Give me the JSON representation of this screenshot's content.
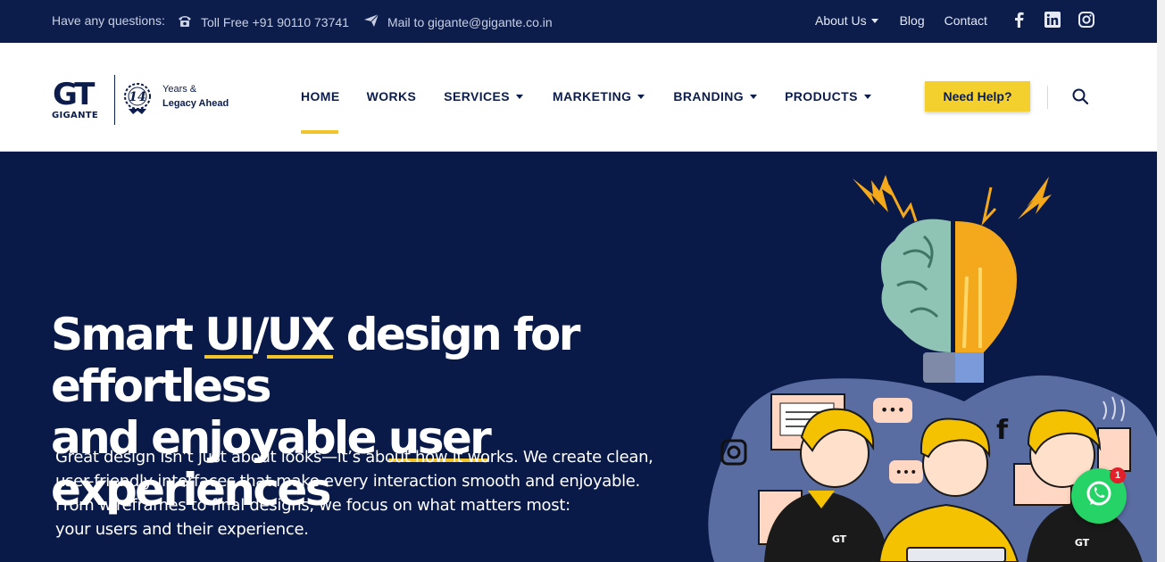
{
  "topbar": {
    "question_label": "Have any questions:",
    "phone_text": "Toll Free +91 90110 73741",
    "mail_text": "Mail to gigante@gigante.co.in",
    "links": {
      "about": "About Us",
      "blog": "Blog",
      "contact": "Contact"
    },
    "socials": [
      "facebook-icon",
      "linkedin-icon",
      "instagram-icon"
    ]
  },
  "logo": {
    "mark": "GT",
    "brand": "GIGANTE",
    "years_number": "14",
    "tagline_line1": "Years &",
    "tagline_line2": "Legacy Ahead"
  },
  "nav": {
    "items": [
      {
        "label": "HOME",
        "active": true
      },
      {
        "label": "WORKS"
      },
      {
        "label": "SERVICES",
        "dropdown": true
      },
      {
        "label": "MARKETING",
        "dropdown": true
      },
      {
        "label": "BRANDING",
        "dropdown": true
      },
      {
        "label": "PRODUCTS",
        "dropdown": true
      }
    ],
    "help_button": "Need Help?"
  },
  "hero": {
    "headline_words": {
      "smart": "Smart",
      "uiux_a": "UI",
      "slash": "/",
      "uiux_b": "UX",
      "rest1": "design for effortless",
      "and": "and enjoyable",
      "user": "user",
      "rest2": "experiences"
    },
    "paragraph_lines": [
      "Great design isn’t just about looks—it’s about how it works. We create clean,",
      "user-friendly interfaces that make every interaction smooth and enjoyable.",
      "From wireframes to final designs, we focus on what matters most:",
      "your users and their experience."
    ]
  },
  "whatsapp": {
    "badge_count": "1"
  },
  "colors": {
    "navy": "#0a1a48",
    "topbar": "#0c1d4c",
    "accent_yellow": "#f1c42b",
    "button_yellow": "#f4d02f",
    "whatsapp_green": "#25d366"
  }
}
